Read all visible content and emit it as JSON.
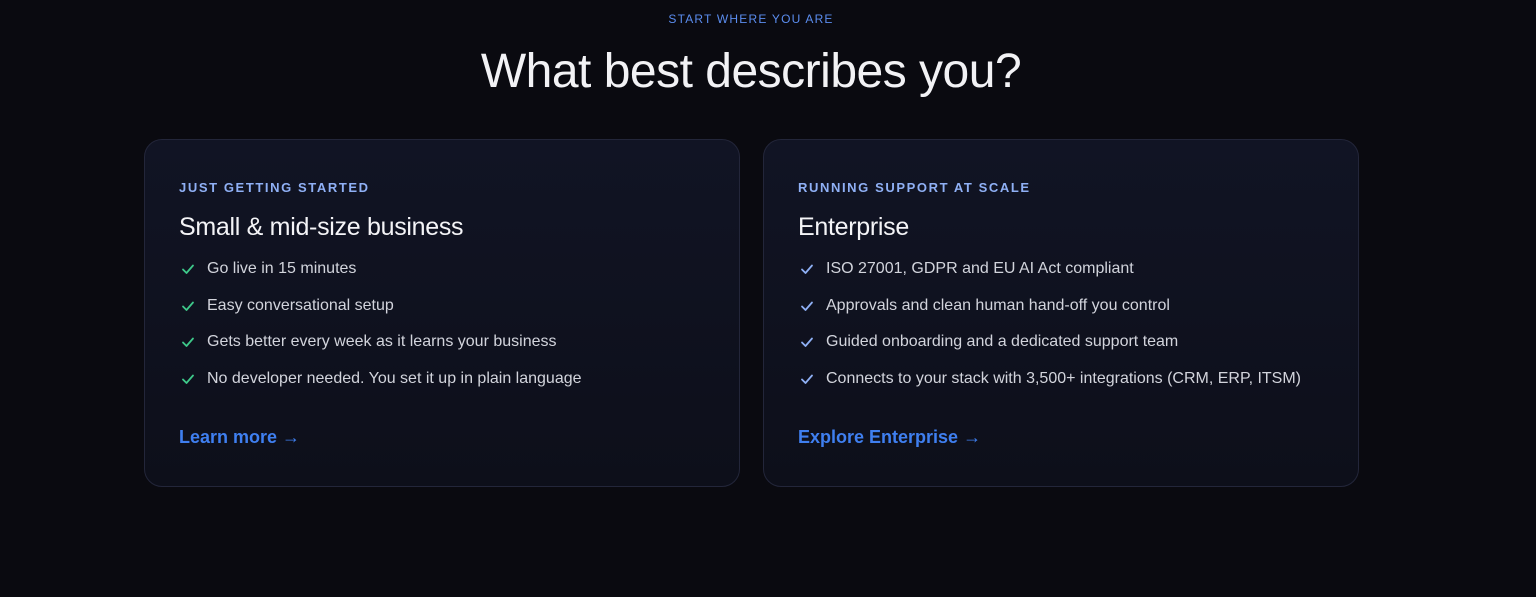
{
  "section": {
    "eyebrow": "START WHERE YOU ARE",
    "headline": "What best describes you?"
  },
  "colors": {
    "background": "#0a0a10",
    "accent_blue": "#3f7ff0",
    "eyebrow_blue": "#5b8def",
    "check_green": "#3ec98a",
    "check_blue": "#8fb0f5"
  },
  "cards": [
    {
      "eyebrow": "JUST GETTING STARTED",
      "title": "Small & mid-size business",
      "features": [
        "Go live in 15 minutes",
        "Easy conversational setup",
        "Gets better every week as it learns your business",
        "No developer needed. You set it up in plain language"
      ],
      "cta_label": "Learn more",
      "cta_arrow": "→",
      "check_icon": "check-icon"
    },
    {
      "eyebrow": "RUNNING SUPPORT AT SCALE",
      "title": "Enterprise",
      "features": [
        "ISO 27001, GDPR and EU AI Act compliant",
        "Approvals and clean human hand-off you control",
        "Guided onboarding and a dedicated support team",
        "Connects to your stack with 3,500+ integrations (CRM, ERP, ITSM)"
      ],
      "cta_label": "Explore Enterprise",
      "cta_arrow": "→",
      "check_icon": "check-icon"
    }
  ]
}
